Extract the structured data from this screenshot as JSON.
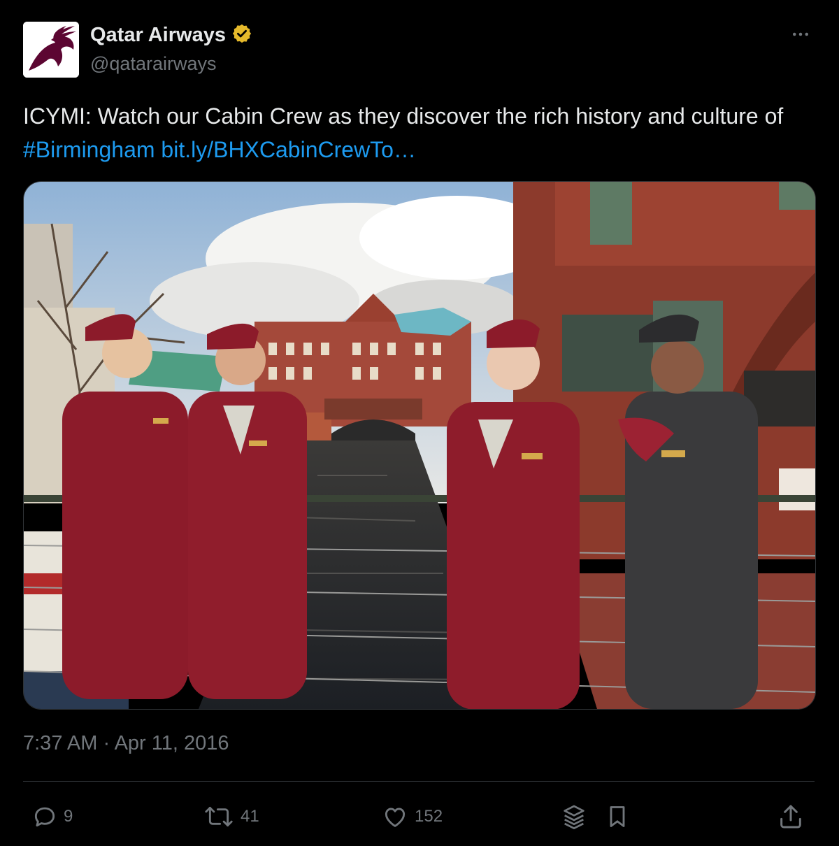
{
  "tweet": {
    "author": {
      "name": "Qatar Airways",
      "handle": "@qatarairways",
      "verified_badge_color": "#e5b92b",
      "avatar_icon": "oryx-logo-icon"
    },
    "text_prefix": "ICYMI: Watch our Cabin Crew as they discover the rich history and culture of ",
    "hashtag": "#Birmingham",
    "link": "bit.ly/BHXCabinCrewTo…",
    "timestamp": "7:37 AM · Apr 11, 2016",
    "actions": {
      "replies": "9",
      "reposts": "41",
      "likes": "152"
    }
  },
  "colors": {
    "background": "#000000",
    "text": "#e7e9ea",
    "muted": "#71767b",
    "link": "#1d9bf0",
    "brand": "#5c0632"
  },
  "icons": [
    "more-icon",
    "reply-icon",
    "repost-icon",
    "like-icon",
    "grok-icon",
    "bookmark-icon",
    "share-icon"
  ]
}
